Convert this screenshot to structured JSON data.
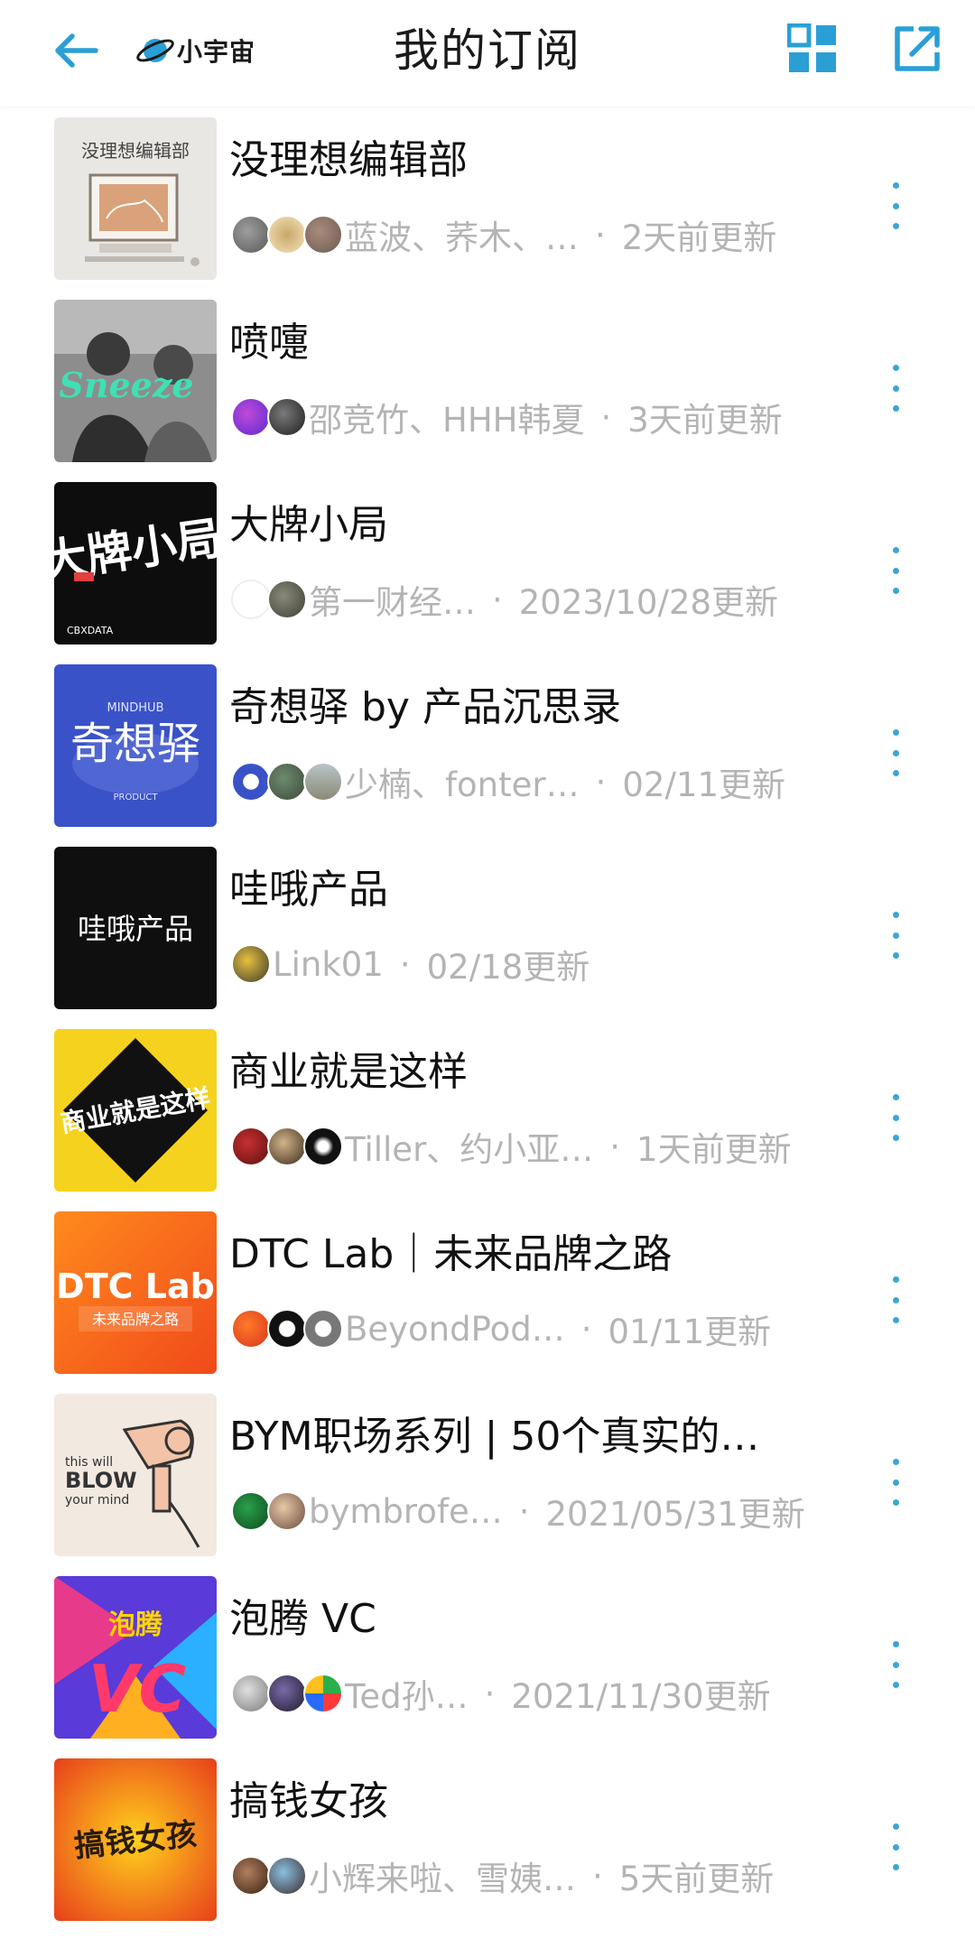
{
  "header": {
    "title": "我的订阅",
    "brand": "小宇宙",
    "accent": "#2a9fd6"
  },
  "subscriptions": [
    {
      "title": "没理想编辑部",
      "cover_text": "没理想编辑部",
      "hosts": "蓝波、荞木、…",
      "updated": "2天前更新"
    },
    {
      "title": "喷嚏",
      "cover_text": "Sneeze",
      "hosts": "邵竞竹、HHH韩夏",
      "updated": "3天前更新"
    },
    {
      "title": "大牌小局",
      "cover_text": "大牌小局",
      "hosts": "第一财经…",
      "updated": "2023/10/28更新"
    },
    {
      "title": "奇想驿 by 产品沉思录",
      "cover_text": "奇想驿",
      "hosts": "少楠、fonter…",
      "updated": "02/11更新"
    },
    {
      "title": "哇哦产品",
      "cover_text": "哇哦产品",
      "hosts": "Link01",
      "updated": "02/18更新"
    },
    {
      "title": "商业就是这样",
      "cover_text": "商业就是这样",
      "hosts": "Tiller、约小亚…",
      "updated": "1天前更新"
    },
    {
      "title": "DTC Lab｜未来品牌之路",
      "cover_text": "DTC Lab",
      "cover_subtext": "未来品牌之路",
      "hosts": "BeyondPod…",
      "updated": "01/11更新"
    },
    {
      "title": "BYM职场系列 | 50个真实的…",
      "cover_text": "BLOW",
      "hosts": "bymbrofe…",
      "updated": "2021/05/31更新"
    },
    {
      "title": "泡腾 VC",
      "cover_text": "泡腾",
      "hosts": "Ted孙…",
      "updated": "2021/11/30更新"
    },
    {
      "title": "搞钱女孩",
      "cover_text": "搞钱女孩",
      "hosts": "小辉来啦、雪姨…",
      "updated": "5天前更新"
    }
  ]
}
